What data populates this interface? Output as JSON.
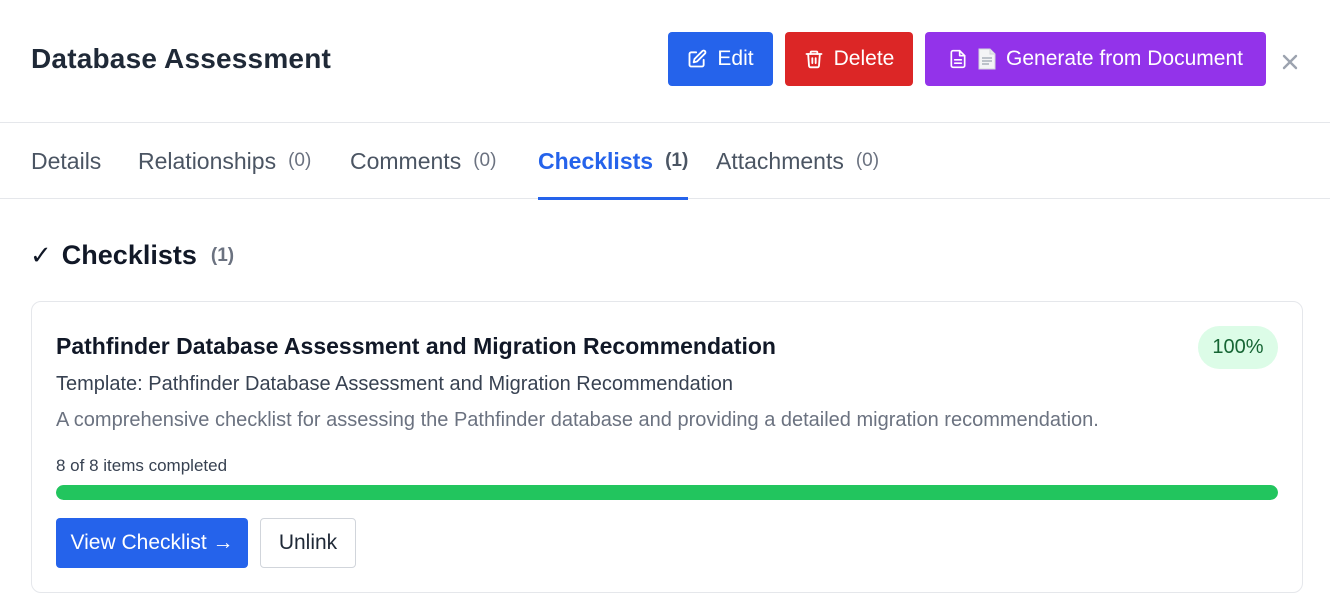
{
  "header": {
    "title": "Database Assessment",
    "edit_label": "Edit",
    "delete_label": "Delete",
    "generate_label": "Generate from Document"
  },
  "tabs": [
    {
      "label": "Details",
      "count": ""
    },
    {
      "label": "Relationships",
      "count": "(0)"
    },
    {
      "label": "Comments",
      "count": "(0)"
    },
    {
      "label": "Checklists",
      "count": "(1)"
    },
    {
      "label": "Attachments",
      "count": "(0)"
    }
  ],
  "active_tab": "Checklists",
  "section": {
    "check_glyph": "✓",
    "title": "Checklists",
    "count": "(1)"
  },
  "checklist": {
    "title": "Pathfinder Database Assessment and Migration Recommendation",
    "percent_label": "100%",
    "template": "Template: Pathfinder Database Assessment and Migration Recommendation",
    "description": "A comprehensive checklist for assessing the Pathfinder database and providing a detailed migration recommendation.",
    "progress_text": "8 of 8 items completed",
    "progress_fraction": 1.0,
    "view_label": "View Checklist →",
    "unlink_label": "Unlink"
  },
  "colors": {
    "primary": "#2563eb",
    "danger": "#dc2626",
    "purple": "#9333ea",
    "success": "#22c55e",
    "badge_bg": "#dcfce7",
    "badge_text": "#166534"
  }
}
